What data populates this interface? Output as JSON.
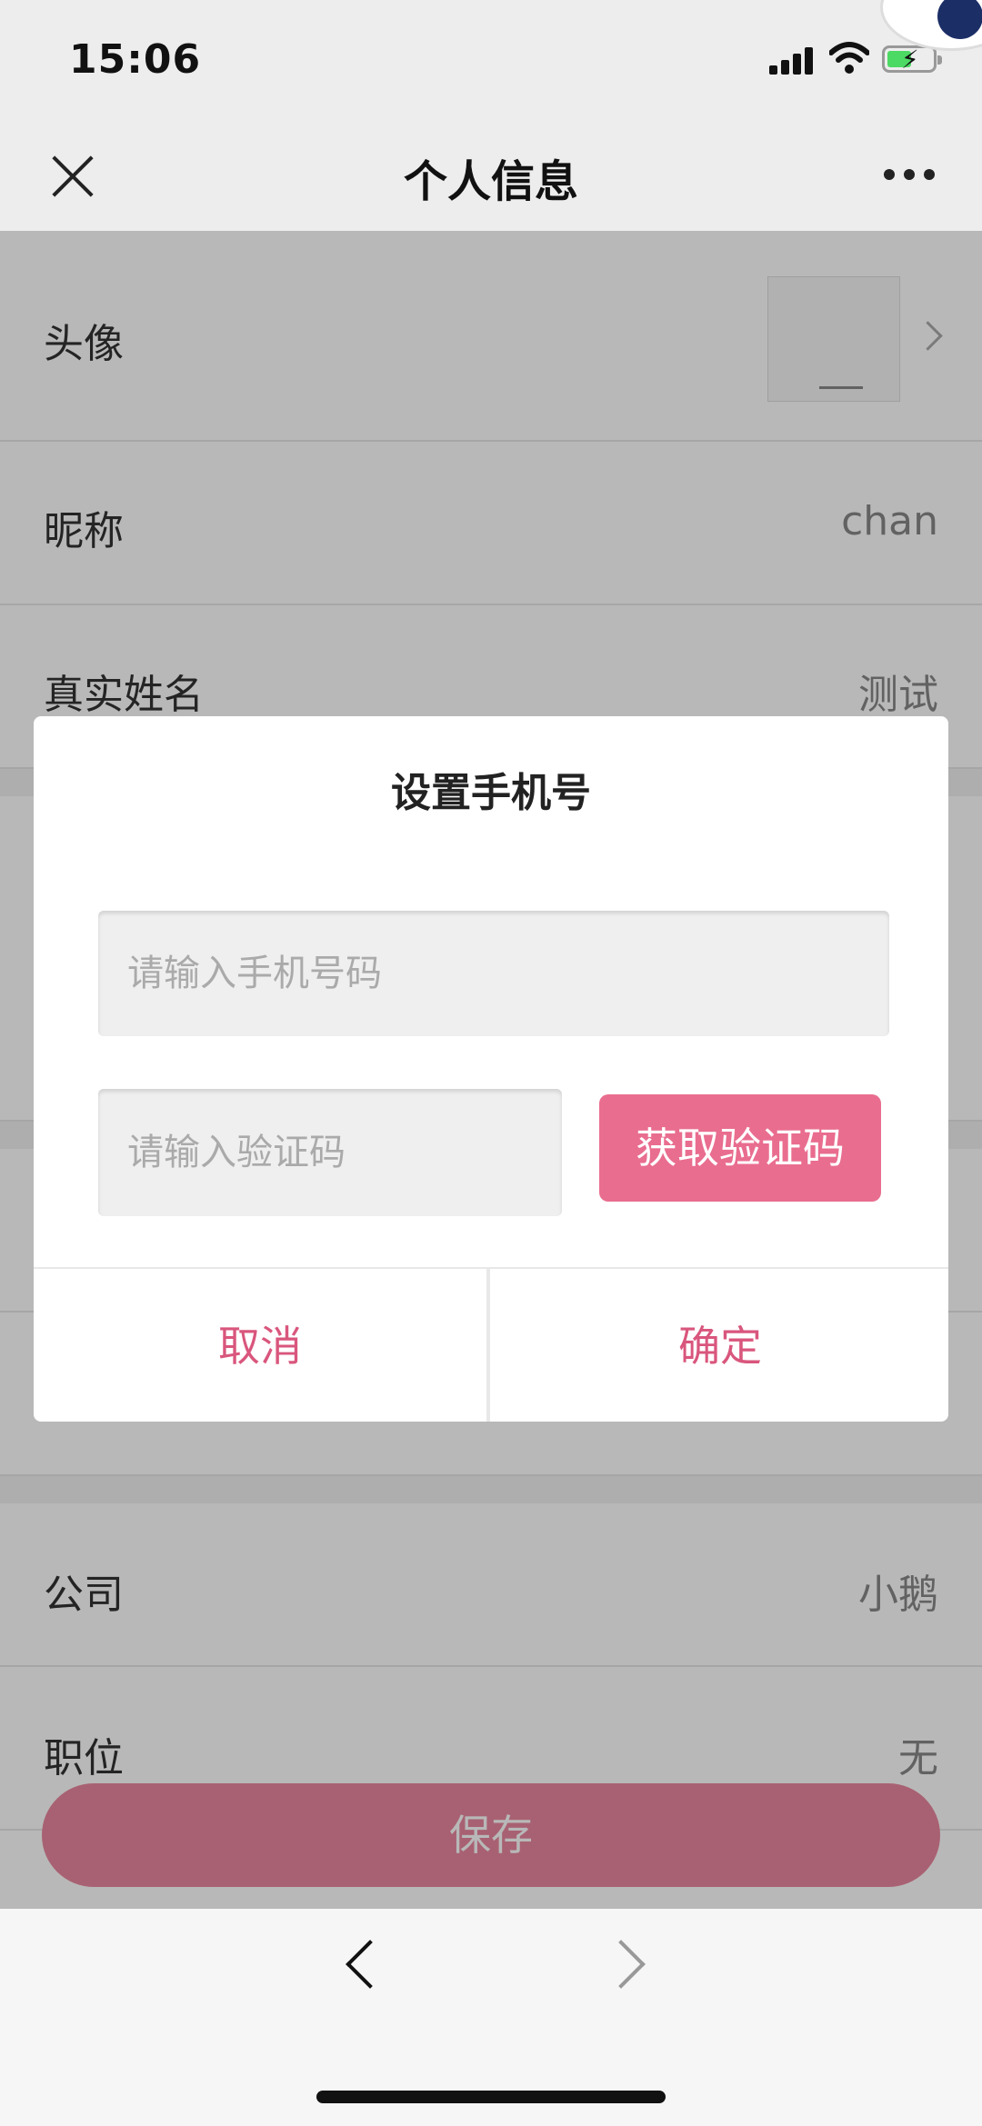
{
  "status_bar": {
    "time": "15:06"
  },
  "nav": {
    "title": "个人信息"
  },
  "profile": {
    "avatar_label": "头像",
    "rows": [
      {
        "label": "昵称",
        "value": "chan"
      },
      {
        "label": "真实姓名",
        "value": "测试"
      },
      {
        "label": "公司",
        "value": "小鹅"
      },
      {
        "label": "职位",
        "value": "无"
      }
    ]
  },
  "save_button": "保存",
  "dialog": {
    "title": "设置手机号",
    "phone_placeholder": "请输入手机号码",
    "code_placeholder": "请输入验证码",
    "get_code_label": "获取验证码",
    "cancel_label": "取消",
    "confirm_label": "确定"
  },
  "colors": {
    "accent": "#e96d8f",
    "dialog_button_text": "#d9567d"
  },
  "icons": [
    "close-icon",
    "more-icon",
    "chevron-right-icon",
    "back-arrow-icon",
    "forward-arrow-icon"
  ]
}
